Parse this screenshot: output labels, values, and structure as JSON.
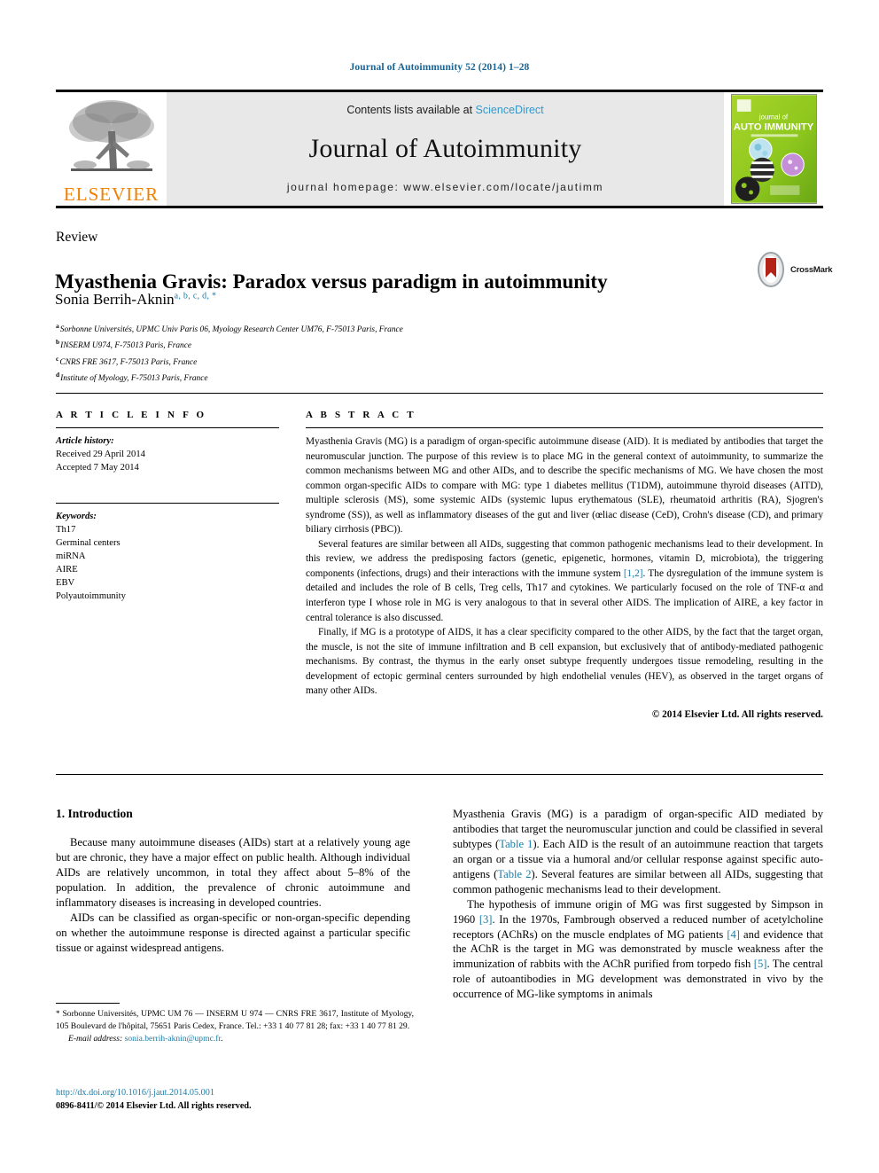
{
  "colors": {
    "link_blue": "#1a7ba8",
    "sciencedirect_blue": "#3399cc",
    "elsevier_orange": "#f08000",
    "masthead_grey": "#e8e8e8"
  },
  "running_head": "Journal of Autoimmunity 52 (2014) 1–28",
  "masthead": {
    "elsevier_wordmark": "ELSEVIER",
    "contents_prefix": "Contents lists available at ",
    "contents_link": "ScienceDirect",
    "journal_title": "Journal of Autoimmunity",
    "homepage_label": "journal homepage: www.elsevier.com/locate/jautimm",
    "cover_lines": {
      "line1": "journal of",
      "line2": "AUTO IMMUNITY"
    }
  },
  "article": {
    "type": "Review",
    "title": "Myasthenia Gravis: Paradox versus paradigm in autoimmunity",
    "author": "Sonia Berrih-Aknin",
    "author_marks": "a, b, c, d, *",
    "crossmark_label": "CrossMark",
    "affiliations": [
      {
        "mark": "a",
        "text": "Sorbonne Universités, UPMC Univ Paris 06, Myology Research Center UM76, F-75013 Paris, France"
      },
      {
        "mark": "b",
        "text": "INSERM U974, F-75013 Paris, France"
      },
      {
        "mark": "c",
        "text": "CNRS FRE 3617, F-75013 Paris, France"
      },
      {
        "mark": "d",
        "text": "Institute of Myology, F-75013 Paris, France"
      }
    ]
  },
  "article_info": {
    "heading": "A R T I C L E   I N F O",
    "history_label": "Article history:",
    "history": [
      "Received 29 April 2014",
      "Accepted 7 May 2014"
    ],
    "keywords_label": "Keywords:",
    "keywords": [
      "Th17",
      "Germinal centers",
      "miRNA",
      "AIRE",
      "EBV",
      "Polyautoimmunity"
    ]
  },
  "abstract": {
    "heading": "A B S T R A C T",
    "paragraph1_a": "Myasthenia Gravis (MG) is a paradigm of organ-specific autoimmune disease (AID). It is mediated by antibodies that target the neuromuscular junction. The purpose of this review is to place MG in the general context of autoimmunity, to summarize the common mechanisms between MG and other AIDs, and to describe the specific mechanisms of MG. We have chosen the most common organ-specific AIDs to compare with MG: type 1 diabetes mellitus (T1DM), autoimmune thyroid diseases (AITD), multiple sclerosis (MS), some systemic AIDs (systemic lupus erythematous (SLE), rheumatoid arthritis (RA), Sjogren's syndrome (SS)), as well as inflammatory diseases of the gut and liver (œliac disease (CeD), Crohn's disease (CD), and primary biliary cirrhosis (PBC)).",
    "paragraph2_a": "Several features are similar between all AIDs, suggesting that common pathogenic mechanisms lead to their development. In this review, we address the predisposing factors (genetic, epigenetic, hormones, vitamin D, microbiota), the triggering components (infections, drugs) and their interactions with the immune system ",
    "paragraph2_ref": "[1,2]",
    "paragraph2_b": ". The dysregulation of the immune system is detailed and includes the role of B cells, Treg cells, Th17 and cytokines. We particularly focused on the role of TNF-α and interferon type I whose role in MG is very analogous to that in several other AIDS. The implication of AIRE, a key factor in central tolerance is also discussed.",
    "paragraph3_a": "Finally, if MG is a prototype of AIDS, it has a clear specificity compared to the other AIDS, by the fact that the target organ, the muscle, is not the site of immune infiltration and B cell expansion, but exclusively that of antibody-mediated pathogenic mechanisms. By contrast, the thymus in the early onset subtype frequently undergoes tissue remodeling, resulting in the development of ectopic germinal centers surrounded by high endothelial venules (HEV), as observed in the target organs of many other AIDs.",
    "copyright": "© 2014 Elsevier Ltd. All rights reserved."
  },
  "body": {
    "section_number_title": "1. Introduction",
    "left_p1": "Because many autoimmune diseases (AIDs) start at a relatively young age but are chronic, they have a major effect on public health. Although individual AIDs are relatively uncommon, in total they affect about 5–8% of the population. In addition, the prevalence of chronic autoimmune and inflammatory diseases is increasing in developed countries.",
    "left_p2": "AIDs can be classified as organ-specific or non-organ-specific depending on whether the autoimmune response is directed against a particular specific tissue or against widespread antigens.",
    "right_p1_a": "Myasthenia Gravis (MG) is a paradigm of organ-specific AID mediated by antibodies that target the neuromuscular junction and could be classified in several subtypes (",
    "right_p1_link1": "Table 1",
    "right_p1_b": "). Each AID is the result of an autoimmune reaction that targets an organ or a tissue via a humoral and/or cellular response against specific auto-antigens (",
    "right_p1_link2": "Table 2",
    "right_p1_c": "). Several features are similar between all AIDs, suggesting that common pathogenic mechanisms lead to their development.",
    "right_p2_a": "The hypothesis of immune origin of MG was first suggested by Simpson in 1960 ",
    "right_p2_ref1": "[3]",
    "right_p2_b": ". In the 1970s, Fambrough observed a reduced number of acetylcholine receptors (AChRs) on the muscle endplates of MG patients ",
    "right_p2_ref2": "[4]",
    "right_p2_c": " and evidence that the AChR is the target in MG was demonstrated by muscle weakness after the immunization of rabbits with the AChR purified from torpedo fish ",
    "right_p2_ref3": "[5]",
    "right_p2_d": ". The central role of autoantibodies in MG development was demonstrated in vivo by the occurrence of MG-like symptoms in animals"
  },
  "footnote": {
    "star": "*",
    "corresponding": " Sorbonne Universités, UPMC UM 76 — INSERM U 974 — CNRS FRE 3617, Institute of Myology, 105 Boulevard de l'hôpital, 75651 Paris Cedex, France. Tel.: +33 1 40 77 81 28; fax: +33 1 40 77 81 29.",
    "email_label": "E-mail address:",
    "email": "sonia.berrih-aknin@upmc.fr",
    "email_trail": ".",
    "doi": "http://dx.doi.org/10.1016/j.jaut.2014.05.001",
    "issn_line": "0896-8411/© 2014 Elsevier Ltd. All rights reserved."
  }
}
